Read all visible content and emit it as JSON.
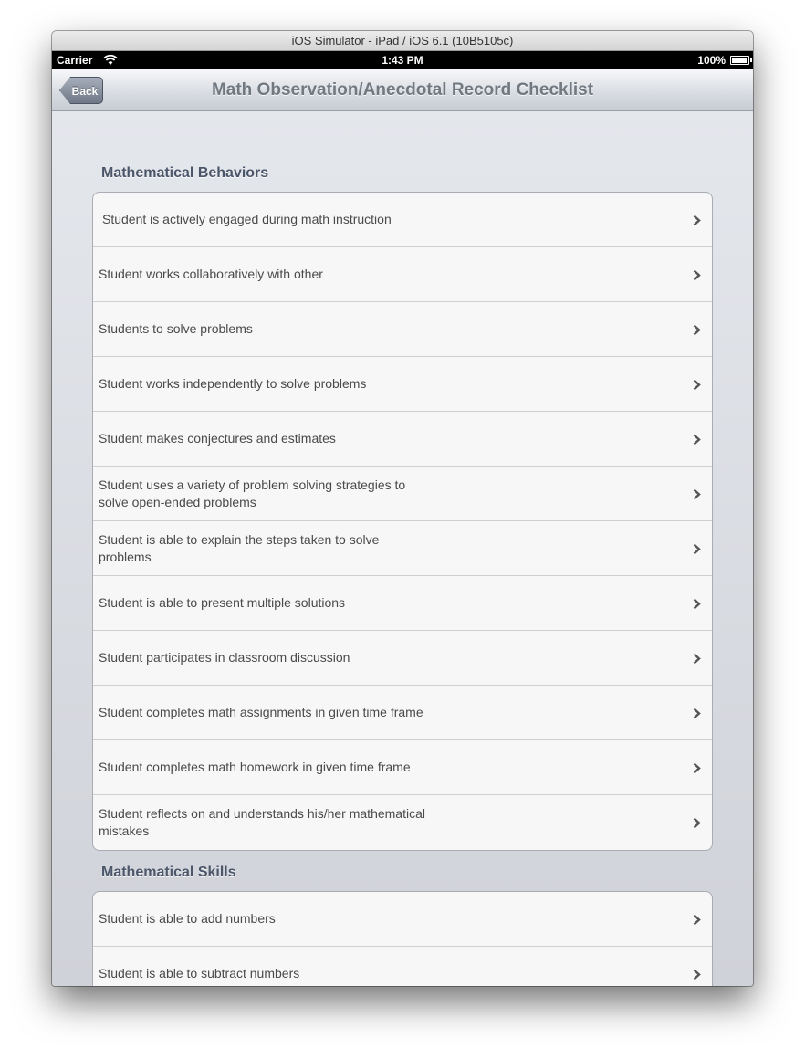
{
  "window": {
    "title": "iOS Simulator - iPad / iOS 6.1 (10B5105c)"
  },
  "status": {
    "carrier": "Carrier",
    "time": "1:43 PM",
    "battery": "100%"
  },
  "nav": {
    "back_label": "Back",
    "title": "Math Observation/Anecdotal Record Checklist"
  },
  "sections": [
    {
      "header": "Mathematical Behaviors",
      "items": [
        "Student is actively engaged during math instruction",
        "Student works collaboratively with other",
        "Students to solve problems",
        "Student works independently to solve problems",
        "Student makes conjectures and estimates",
        "Student uses a variety of problem solving strategies to solve open-ended problems",
        "Student is able to explain the steps taken to solve problems",
        "Student is able to present multiple solutions",
        "Student participates in classroom discussion",
        "Student completes math assignments in given time frame",
        "Student completes math homework in given time frame",
        "Student reflects on and understands his/her mathematical mistakes"
      ]
    },
    {
      "header": "Mathematical Skills",
      "items": [
        "Student is able to add numbers",
        "Student is able to subtract numbers",
        ""
      ]
    }
  ]
}
